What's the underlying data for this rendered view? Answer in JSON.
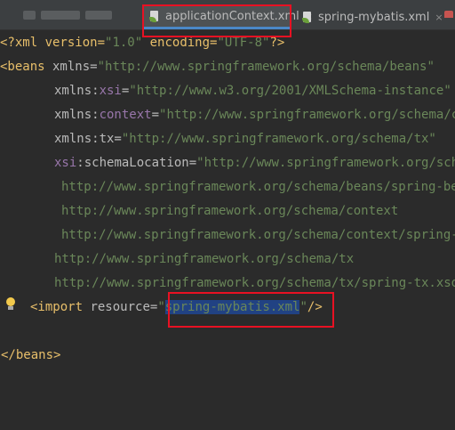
{
  "tabs": [
    {
      "label": "applicationContext.xml",
      "close": "×",
      "active": true
    },
    {
      "label": "spring-mybatis.xml",
      "close": "×",
      "active": false
    }
  ],
  "code": {
    "line1": {
      "a": "<?xml version=",
      "b": "\"1.0\"",
      "c": " encoding=",
      "d": "\"UTF-8\"",
      "e": "?>"
    },
    "line2": {
      "tag": "<beans",
      "attr": " xmlns=",
      "val": "\"http://www.springframework.org/schema/beans\""
    },
    "line3": {
      "attr": "xmlns:",
      "ns": "xsi",
      "eq": "=",
      "val": "\"http://www.w3.org/2001/XMLSchema-instance\""
    },
    "line4": {
      "attr": "xmlns:",
      "ns": "context",
      "eq": "=",
      "val": "\"http://www.springframework.org/schema/context\""
    },
    "line5": {
      "attr": "xmlns:tx=",
      "val": "\"http://www.springframework.org/schema/tx\""
    },
    "line6": {
      "ns": "xsi",
      "attr": ":schemaLocation=",
      "val": "\"http://www.springframework.org/schema/beans"
    },
    "line7": "http://www.springframework.org/schema/beans/spring-beans.xsd",
    "line8": "http://www.springframework.org/schema/context",
    "line9": "http://www.springframework.org/schema/context/spring-context.xsd",
    "line10": "http://www.springframework.org/schema/tx",
    "line11": "http://www.springframework.org/schema/tx/spring-tx.xsd\">",
    "line12": {
      "tag": "<import",
      "attr": " resource=",
      "q1": "\"",
      "sel": "spring-mybatis.xml",
      "q2": "\"",
      "end": "/>"
    },
    "line14": "</beans>"
  },
  "colors": {
    "background": "#2b2b2b",
    "tag": "#e8bf6a",
    "attribute": "#bababa",
    "namespace": "#9876aa",
    "string": "#6a8759",
    "selection": "#214283",
    "annotation": "#e81123"
  }
}
